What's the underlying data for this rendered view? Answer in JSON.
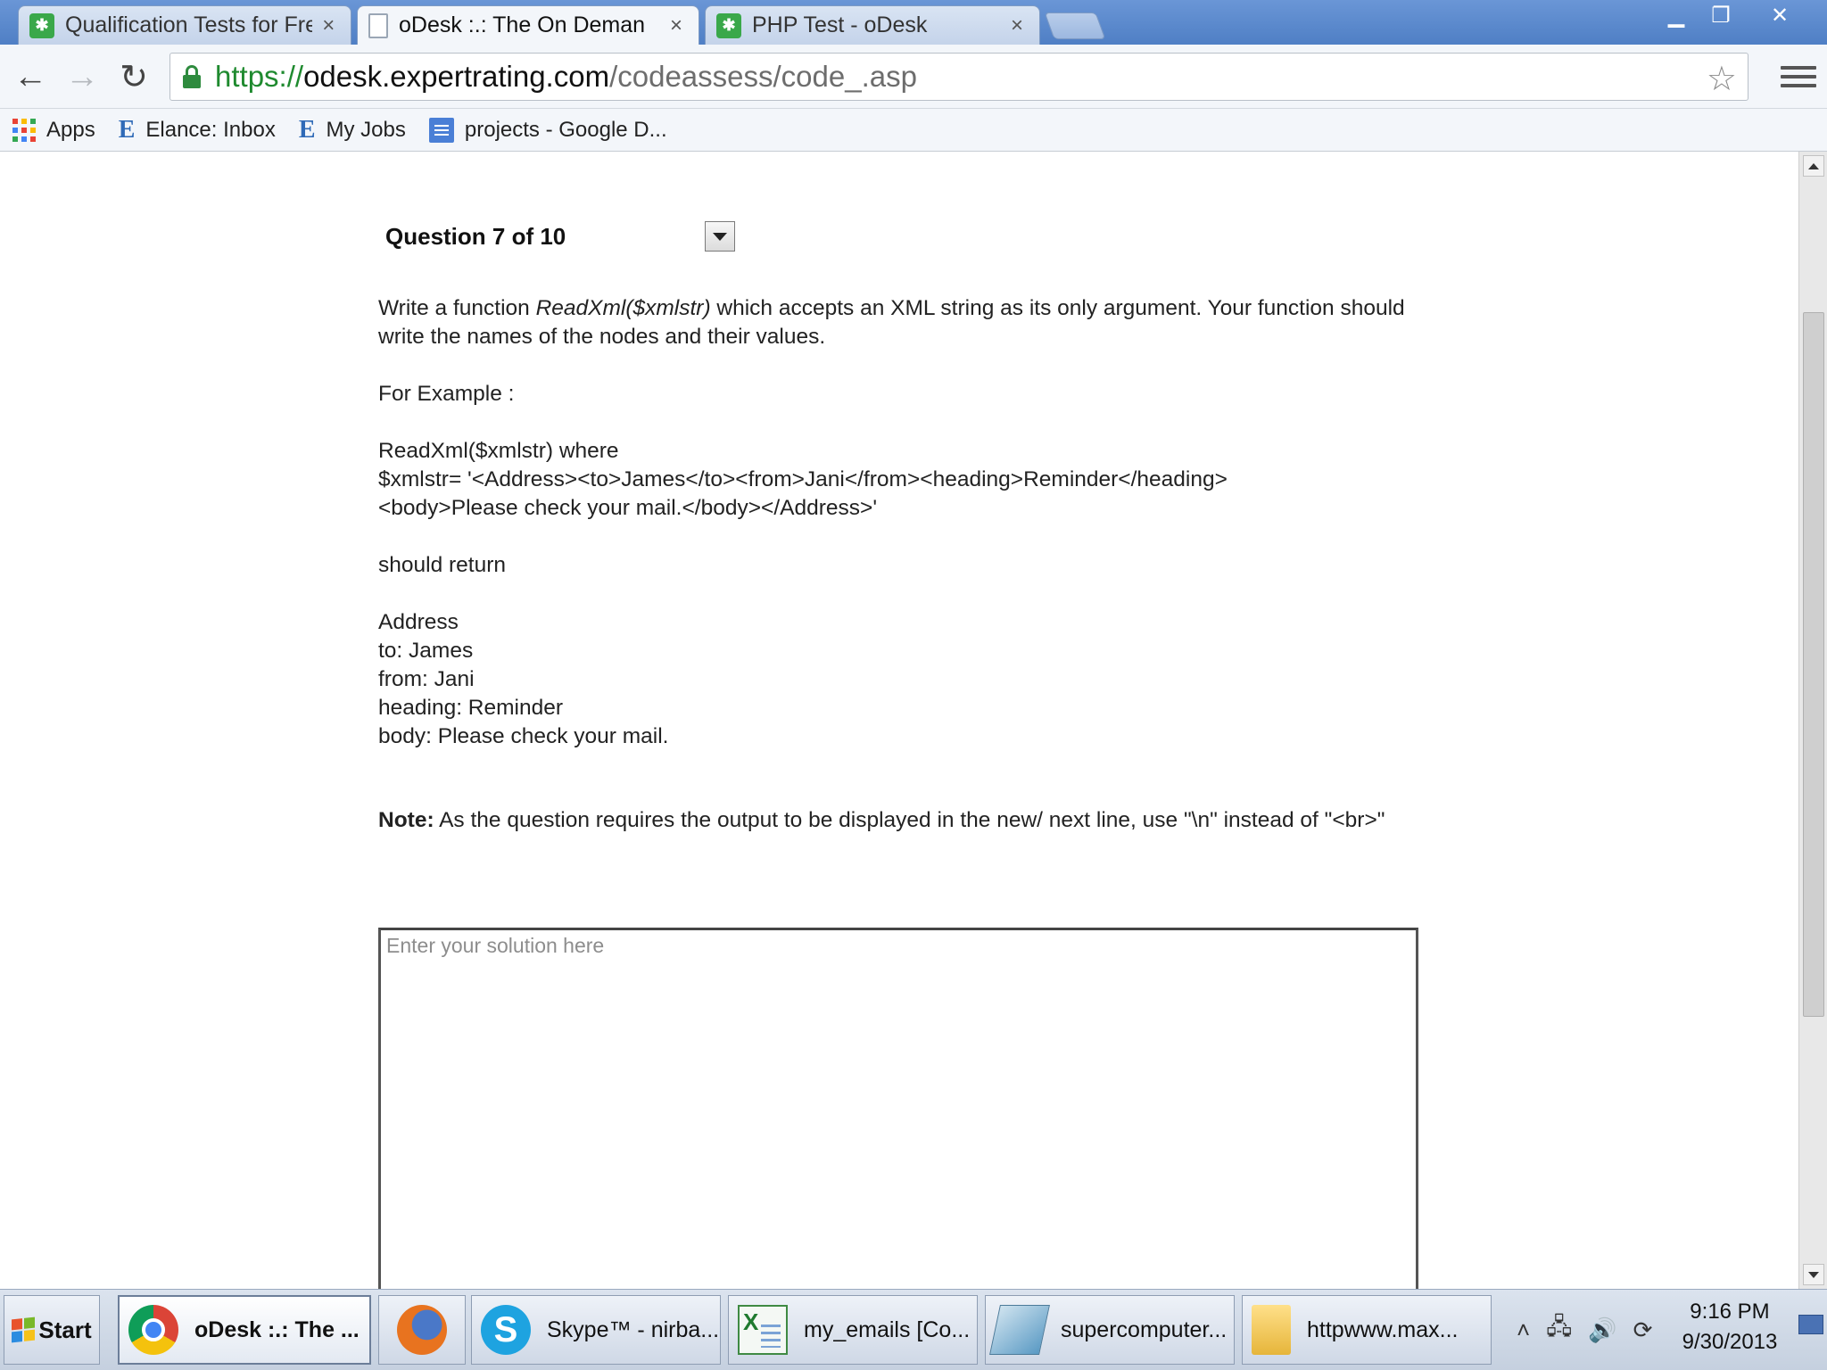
{
  "browser": {
    "tabs": [
      {
        "title": "Qualification Tests for Fre",
        "active": false,
        "icon": "odesk-icon"
      },
      {
        "title": "oDesk :.: The On Deman",
        "active": true,
        "icon": "document-icon"
      },
      {
        "title": "PHP Test - oDesk",
        "active": false,
        "icon": "odesk-icon"
      }
    ],
    "close_glyph": "×",
    "url": {
      "scheme": "https://",
      "host": "odesk.expertrating.com",
      "path": "/codeassess/code_.asp"
    },
    "bookmarks": [
      {
        "label": "Apps",
        "icon": "apps-grid-icon"
      },
      {
        "label": "Elance: Inbox",
        "icon": "elance-icon"
      },
      {
        "label": "My Jobs",
        "icon": "elance-icon"
      },
      {
        "label": "projects - Google D...",
        "icon": "google-docs-icon"
      }
    ]
  },
  "question": {
    "header": "Question 7 of 10",
    "intro_pre": "Write a function ",
    "intro_fn": "ReadXml($xmlstr)",
    "intro_post": " which accepts an XML string as its only argument. Your function should write the names of the nodes and their values.",
    "example_label": "For Example :",
    "example_call": "ReadXml($xmlstr) where",
    "example_xml_line1": "$xmlstr= '<Address><to>James</to><from>Jani</from><heading>Reminder</heading>",
    "example_xml_line2": "<body>Please check your mail.</body></Address>'",
    "should_return": "should return",
    "output_lines": [
      "Address",
      "to: James",
      "from: Jani",
      "heading: Reminder",
      "body: Please check your mail."
    ],
    "note_label": "Note:",
    "note_text": " As the question requires the output to be displayed in the new/ next line, use \"\\n\" instead of \"<br>\""
  },
  "solution": {
    "placeholder": "Enter your solution here",
    "value": ""
  },
  "taskbar": {
    "start_label": "Start",
    "items": [
      {
        "label": "oDesk :.: The ...",
        "icon": "chrome-icon",
        "active": true
      },
      {
        "label": "",
        "icon": "firefox-icon",
        "active": false
      },
      {
        "label": "Skype™ - nirba...",
        "icon": "skype-icon",
        "active": false
      },
      {
        "label": "my_emails  [Co...",
        "icon": "excel-icon",
        "active": false
      },
      {
        "label": "supercomputer...",
        "icon": "app-icon",
        "active": false
      },
      {
        "label": "httpwww.max...",
        "icon": "folder-icon",
        "active": false
      }
    ],
    "clock_time": "9:16 PM",
    "clock_date": "9/30/2013"
  },
  "colors": {
    "url_scheme": "#1f8a2f",
    "tab_strip": "#4f7fc5",
    "odesk_green": "#3aa84a"
  }
}
